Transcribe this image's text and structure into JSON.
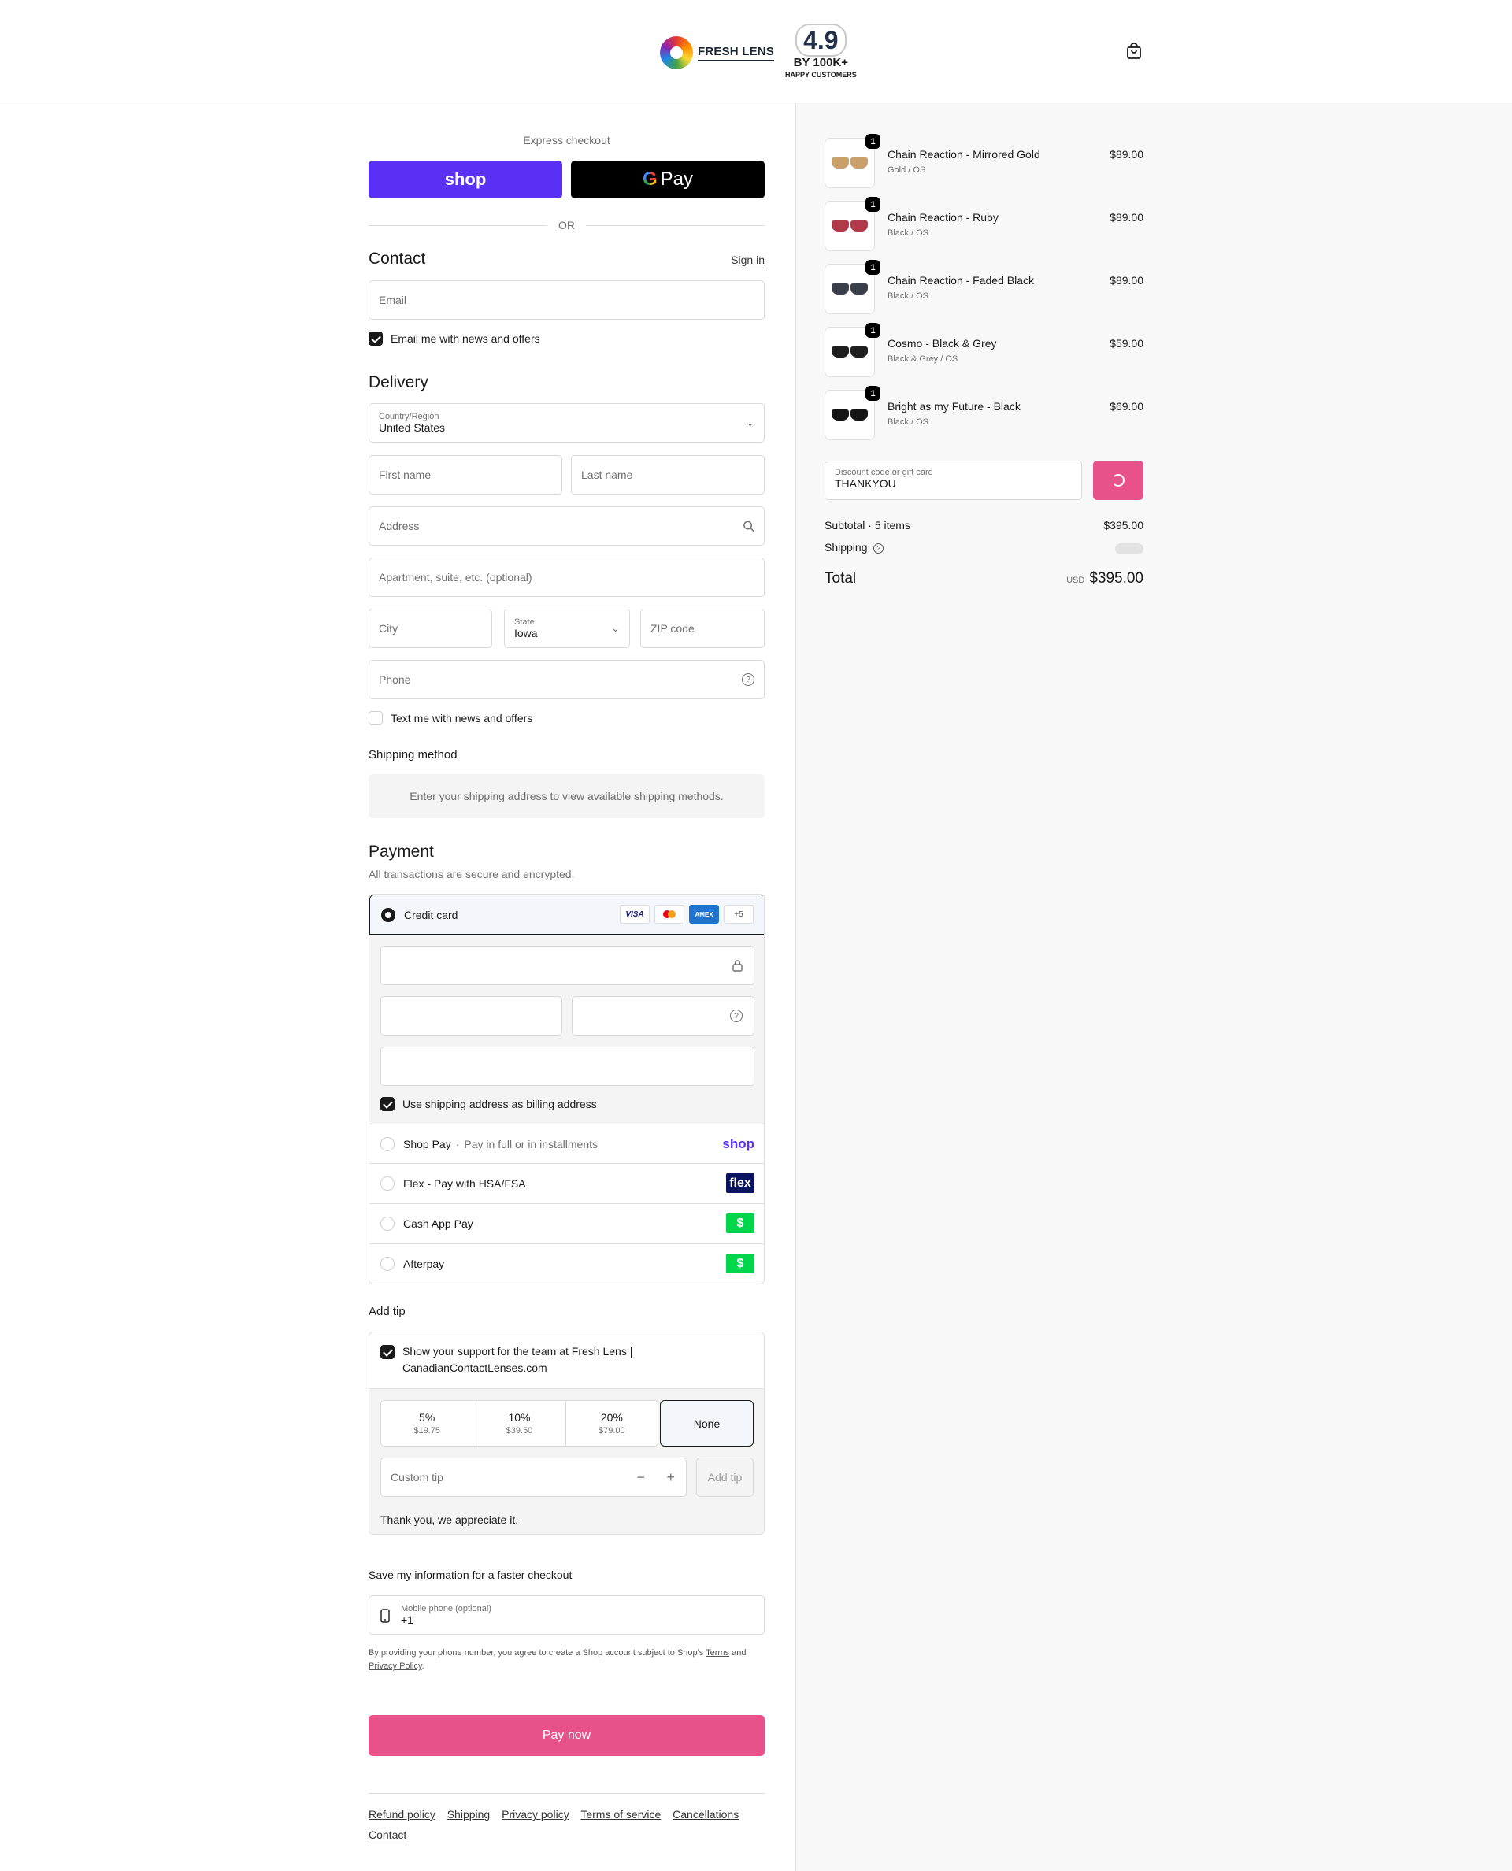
{
  "header": {
    "logo_text": "FRESH LENS",
    "rating_value": "4.9",
    "rating_by": "BY 100K+",
    "rating_caption": "HAPPY CUSTOMERS"
  },
  "express": {
    "label": "Express checkout",
    "shop_label": "shop",
    "gpay_label": "Pay",
    "or_label": "OR"
  },
  "contact": {
    "title": "Contact",
    "sign_in": "Sign in",
    "email_placeholder": "Email",
    "news_label": "Email me with news and offers",
    "news_checked": true
  },
  "delivery": {
    "title": "Delivery",
    "country_label": "Country/Region",
    "country_value": "United States",
    "first_name": "First name",
    "last_name": "Last name",
    "address": "Address",
    "apartment": "Apartment, suite, etc. (optional)",
    "city": "City",
    "state_label": "State",
    "state_value": "Iowa",
    "zip": "ZIP code",
    "phone": "Phone",
    "text_label": "Text me with news and offers",
    "text_checked": false
  },
  "shipping_method": {
    "title": "Shipping method",
    "notice": "Enter your shipping address to view available shipping methods."
  },
  "payment": {
    "title": "Payment",
    "subtitle": "All transactions are secure and encrypted.",
    "credit_card_label": "Credit card",
    "card_icons": [
      "VISA",
      "mastercard",
      "AMEX",
      "+5"
    ],
    "billing_label": "Use shipping address as billing address",
    "billing_checked": true,
    "methods": [
      {
        "label": "Shop Pay",
        "sub": "Pay in full or in installments",
        "logo": "shop"
      },
      {
        "label": "Flex - Pay with HSA/FSA",
        "logo": "flex"
      },
      {
        "label": "Cash App Pay",
        "logo": "$"
      },
      {
        "label": "Afterpay",
        "logo": "$"
      }
    ]
  },
  "tip": {
    "title": "Add tip",
    "support_label": "Show your support for the team at Fresh Lens | CanadianContactLenses.com",
    "support_checked": true,
    "options": [
      {
        "pct": "5%",
        "amount": "$19.75"
      },
      {
        "pct": "10%",
        "amount": "$39.50"
      },
      {
        "pct": "20%",
        "amount": "$79.00"
      }
    ],
    "none_label": "None",
    "custom_placeholder": "Custom tip",
    "add_tip_label": "Add tip",
    "thanks": "Thank you, we appreciate it."
  },
  "save_info": {
    "title": "Save my information for a faster checkout",
    "phone_label": "Mobile phone (optional)",
    "phone_value": "+1",
    "disclaimer_prefix": "By providing your phone number, you agree to create a Shop account subject to Shop's",
    "terms_link": "Terms",
    "and": "and",
    "privacy_link": "Privacy Policy",
    "period": "."
  },
  "pay_now_label": "Pay now",
  "footer_links": [
    "Refund policy",
    "Shipping",
    "Privacy policy",
    "Terms of service",
    "Cancellations",
    "Contact"
  ],
  "order": {
    "items": [
      {
        "name": "Chain Reaction - Mirrored Gold",
        "variant": "Gold / OS",
        "price": "$89.00",
        "qty": "1",
        "lens_color": "#c9a06a"
      },
      {
        "name": "Chain Reaction - Ruby",
        "variant": "Black / OS",
        "price": "$89.00",
        "qty": "1",
        "lens_color": "#b03a4a"
      },
      {
        "name": "Chain Reaction - Faded Black",
        "variant": "Black / OS",
        "price": "$89.00",
        "qty": "1",
        "lens_color": "#3b3f4a"
      },
      {
        "name": "Cosmo - Black & Grey",
        "variant": "Black & Grey / OS",
        "price": "$59.00",
        "qty": "1",
        "lens_color": "#1e1e1e"
      },
      {
        "name": "Bright as my Future - Black",
        "variant": "Black / OS",
        "price": "$69.00",
        "qty": "1",
        "lens_color": "#141414"
      }
    ],
    "discount_label": "Discount code or gift card",
    "discount_value": "THANKYOU",
    "subtotal_label": "Subtotal · 5 items",
    "subtotal_value": "$395.00",
    "shipping_label": "Shipping",
    "total_label": "Total",
    "currency": "USD",
    "total_value": "$395.00"
  },
  "colors": {
    "accent": "#e8528b",
    "shop_purple": "#5a31f4"
  }
}
